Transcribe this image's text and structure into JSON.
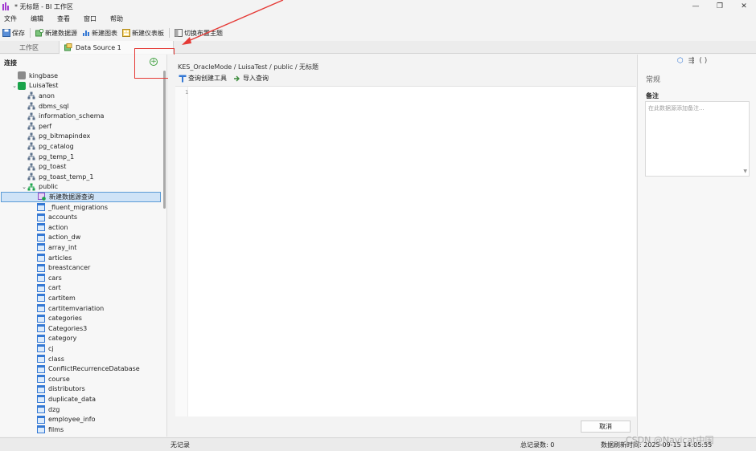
{
  "window": {
    "title": "* 无标题 - BI 工作区",
    "controls": [
      "—",
      "❐",
      "✕"
    ]
  },
  "menu": [
    "文件",
    "编辑",
    "查看",
    "窗口",
    "帮助"
  ],
  "toolbar": {
    "save": "保存",
    "new_datasource": "新建数据源",
    "new_chart": "新建图表",
    "new_dashboard": "新建仪表板",
    "toggle_theme": "切换布置主题"
  },
  "tabs": {
    "workspace": "工作区",
    "datasource": "Data Source 1"
  },
  "left": {
    "header": "连接",
    "tree": [
      {
        "label": "kingbase",
        "icon": "db-gray",
        "level": 1,
        "chev": ""
      },
      {
        "label": "LuisaTest",
        "icon": "db-green",
        "level": 1,
        "chev": "⌄"
      },
      {
        "label": "anon",
        "icon": "schema",
        "level": 2,
        "chev": ""
      },
      {
        "label": "dbms_sql",
        "icon": "schema",
        "level": 2,
        "chev": ""
      },
      {
        "label": "information_schema",
        "icon": "schema",
        "level": 2,
        "chev": ""
      },
      {
        "label": "perf",
        "icon": "schema",
        "level": 2,
        "chev": ""
      },
      {
        "label": "pg_bitmapindex",
        "icon": "schema",
        "level": 2,
        "chev": ""
      },
      {
        "label": "pg_catalog",
        "icon": "schema",
        "level": 2,
        "chev": ""
      },
      {
        "label": "pg_temp_1",
        "icon": "schema",
        "level": 2,
        "chev": ""
      },
      {
        "label": "pg_toast",
        "icon": "schema",
        "level": 2,
        "chev": ""
      },
      {
        "label": "pg_toast_temp_1",
        "icon": "schema",
        "level": 2,
        "chev": ""
      },
      {
        "label": "public",
        "icon": "schema-green",
        "level": 2,
        "chev": "⌄"
      },
      {
        "label": "新建数据源查询",
        "icon": "query",
        "level": 3,
        "chev": "",
        "selected": true
      },
      {
        "label": "_fluent_migrations",
        "icon": "table",
        "level": 3,
        "chev": ""
      },
      {
        "label": "accounts",
        "icon": "table",
        "level": 3,
        "chev": ""
      },
      {
        "label": "action",
        "icon": "table",
        "level": 3,
        "chev": ""
      },
      {
        "label": "action_dw",
        "icon": "table",
        "level": 3,
        "chev": ""
      },
      {
        "label": "array_int",
        "icon": "table",
        "level": 3,
        "chev": ""
      },
      {
        "label": "articles",
        "icon": "table",
        "level": 3,
        "chev": ""
      },
      {
        "label": "breastcancer",
        "icon": "table",
        "level": 3,
        "chev": ""
      },
      {
        "label": "cars",
        "icon": "table",
        "level": 3,
        "chev": ""
      },
      {
        "label": "cart",
        "icon": "table",
        "level": 3,
        "chev": ""
      },
      {
        "label": "cartitem",
        "icon": "table",
        "level": 3,
        "chev": ""
      },
      {
        "label": "cartitemvariation",
        "icon": "table",
        "level": 3,
        "chev": ""
      },
      {
        "label": "categories",
        "icon": "table",
        "level": 3,
        "chev": ""
      },
      {
        "label": "Categories3",
        "icon": "table",
        "level": 3,
        "chev": ""
      },
      {
        "label": "category",
        "icon": "table",
        "level": 3,
        "chev": ""
      },
      {
        "label": "cj",
        "icon": "table",
        "level": 3,
        "chev": ""
      },
      {
        "label": "class",
        "icon": "table",
        "level": 3,
        "chev": ""
      },
      {
        "label": "ConflictRecurrenceDatabase",
        "icon": "table",
        "level": 3,
        "chev": ""
      },
      {
        "label": "course",
        "icon": "table",
        "level": 3,
        "chev": ""
      },
      {
        "label": "distributors",
        "icon": "table",
        "level": 3,
        "chev": ""
      },
      {
        "label": "duplicate_data",
        "icon": "table",
        "level": 3,
        "chev": ""
      },
      {
        "label": "dzg",
        "icon": "table",
        "level": 3,
        "chev": ""
      },
      {
        "label": "employee_info",
        "icon": "table",
        "level": 3,
        "chev": ""
      },
      {
        "label": "films",
        "icon": "table",
        "level": 3,
        "chev": ""
      }
    ]
  },
  "editor": {
    "breadcrumb": "KES_OracleMode / LuisaTest / public / 无标题",
    "query_builder": "查询创建工具",
    "import_query": "导入查询",
    "line_number": "1",
    "cancel": "取消"
  },
  "right": {
    "section": "常规",
    "notes_label": "备注",
    "notes_placeholder": "在此数据源添加备注..."
  },
  "status": {
    "no_records": "无记录",
    "total_records": "总记录数: 0",
    "refresh_time": "数据刷新时间: 2025-09-15 14:05:55"
  },
  "watermark": "CSDN @Navicat中国",
  "colors": {
    "accent_blue": "#3478d4",
    "green": "#1aa34a",
    "annotation_red": "#e53935",
    "selected_bg": "#cfe3f7"
  }
}
